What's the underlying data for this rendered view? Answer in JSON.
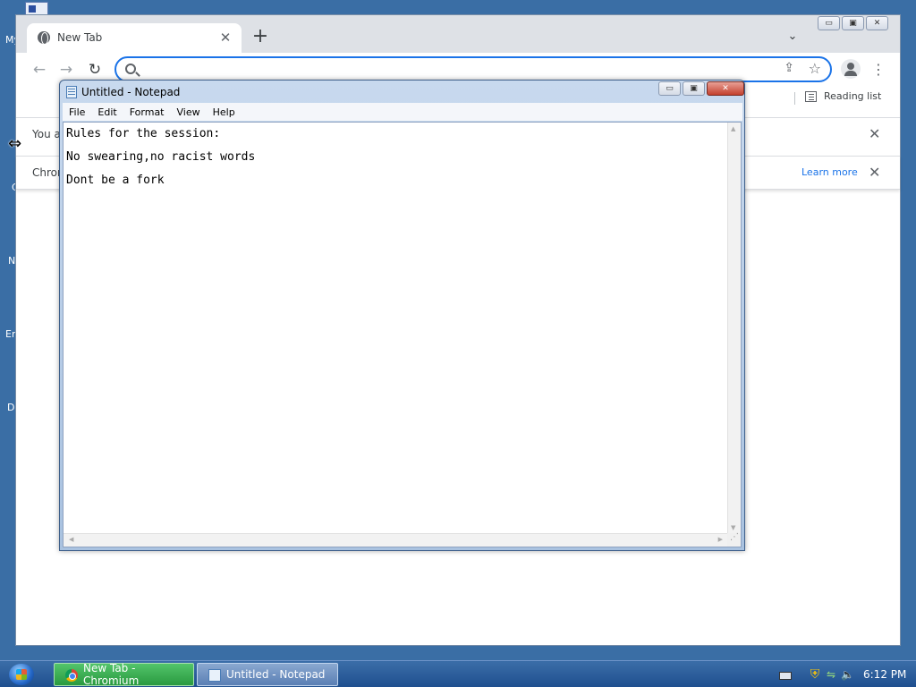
{
  "desktop": {
    "fragments": [
      "My",
      "C",
      "N",
      "Er",
      "D"
    ]
  },
  "chrome": {
    "tab_title": "New Tab",
    "tab_close": "✕",
    "new_tab": "+",
    "tab_search": "⌄",
    "window_controls": {
      "minimize": "▭",
      "maximize": "▣",
      "close": "✕"
    },
    "toolbar": {
      "back": "←",
      "forward": "→",
      "reload": "↻",
      "omnibox_value": "",
      "share": "⇪",
      "star": "☆",
      "menu": "⋮"
    },
    "bookmarks": {
      "reading_list_label": "Reading list"
    },
    "infobars": [
      {
        "text": "You ar",
        "close": "✕"
      },
      {
        "text": "Chron",
        "learn_more": "Learn more",
        "close": "✕"
      }
    ]
  },
  "notepad": {
    "title": "Untitled - Notepad",
    "window_controls": {
      "minimize": "▭",
      "maximize": "▣",
      "close": "✕"
    },
    "menu": [
      "File",
      "Edit",
      "Format",
      "View",
      "Help"
    ],
    "content": "Rules for the session:\nNo swearing,no racist words\nDont be a fork",
    "scroll_up": "▲",
    "scroll_down": "▼",
    "scroll_left": "◀",
    "scroll_right": "▶"
  },
  "taskbar": {
    "buttons": [
      {
        "label": "New Tab - Chromium",
        "icon": "chromium-icon"
      },
      {
        "label": "Untitled - Notepad",
        "icon": "notepad-icon"
      }
    ],
    "tray": {
      "shield": "⛨",
      "network": "⇋",
      "volume": "🔈"
    },
    "clock": "6:12 PM"
  },
  "colors": {
    "desktop_bg": "#3a6ea5",
    "omnibox_focus": "#1a73e8",
    "link": "#1a73e8",
    "taskbar_active": "#2a9a40"
  }
}
